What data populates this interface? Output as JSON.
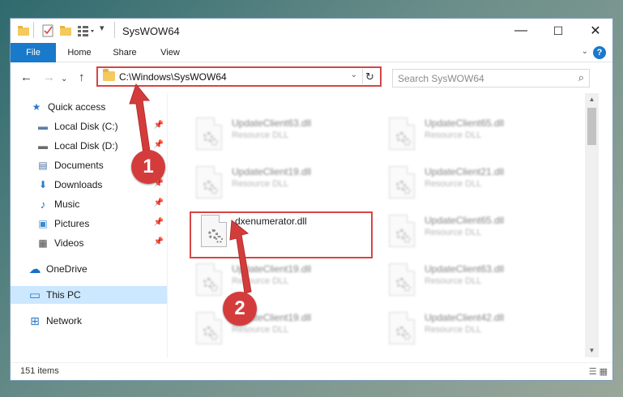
{
  "window": {
    "title": "SysWOW64",
    "controls": {
      "minimize": "—",
      "maximize": "☐",
      "close": "✕"
    }
  },
  "ribbon": {
    "tabs": [
      {
        "label": "File"
      },
      {
        "label": "Share"
      },
      {
        "label": "View"
      }
    ],
    "home_label": "Home",
    "help": "?",
    "collapse": "⌄"
  },
  "navbar": {
    "back": "←",
    "forward": "→",
    "recent": "⌄",
    "up": "↑",
    "path": "C:\\Windows\\SysWOW64",
    "dropdown": "⌄",
    "refresh": "↻",
    "search_placeholder": "Search SysWOW64",
    "search_icon": "⌕"
  },
  "sidebar": {
    "items": [
      {
        "label": "Quick access",
        "icon": "star-icon",
        "glyph": "★",
        "color": "#2a79c8"
      },
      {
        "label": "Local Disk (C:)",
        "icon": "drive-icon",
        "glyph": "▬",
        "color": "#5b7fa6",
        "pinned": "📌"
      },
      {
        "label": "Local Disk (D:)",
        "icon": "drive-icon",
        "glyph": "▬",
        "color": "#6a6a6a",
        "pinned": "📌"
      },
      {
        "label": "Documents",
        "icon": "documents-icon",
        "glyph": "▤",
        "color": "#4a6fa0",
        "pinned": "📌"
      },
      {
        "label": "Downloads",
        "icon": "download-icon",
        "glyph": "⬇",
        "color": "#2a79c8",
        "pinned": "📌"
      },
      {
        "label": "Music",
        "icon": "music-icon",
        "glyph": "♪",
        "color": "#2a79c8",
        "pinned": "📌"
      },
      {
        "label": "Pictures",
        "icon": "pictures-icon",
        "glyph": "▣",
        "color": "#3a8ad0",
        "pinned": "📌"
      },
      {
        "label": "Videos",
        "icon": "videos-icon",
        "glyph": "▦",
        "color": "#444",
        "pinned": "📌"
      },
      {
        "label": "OneDrive",
        "icon": "cloud-icon",
        "glyph": "☁",
        "color": "#1a6fc9"
      },
      {
        "label": "This PC",
        "icon": "computer-icon",
        "glyph": "▭",
        "color": "#2a79c8"
      },
      {
        "label": "Network",
        "icon": "network-icon",
        "glyph": "⊞",
        "color": "#2a79c8"
      }
    ]
  },
  "files": {
    "left": [
      {
        "name": "UpdateClient63.dll",
        "type": "Resource DLL"
      },
      {
        "name": "UpdateClient19.dll",
        "type": "Resource DLL"
      },
      {
        "name": "dxenumerator.dll",
        "type": ""
      },
      {
        "name": "UpdateClient19.dll",
        "type": "Resource DLL"
      },
      {
        "name": "UpdateClient19.dll",
        "type": "Resource DLL"
      }
    ],
    "right": [
      {
        "name": "UpdateClient65.dll",
        "type": "Resource DLL"
      },
      {
        "name": "UpdateClient21.dll",
        "type": "Resource DLL"
      },
      {
        "name": "UpdateClient65.dll",
        "type": "Resource DLL"
      },
      {
        "name": "UpdateClient63.dll",
        "type": "Resource DLL"
      },
      {
        "name": "UpdateClient42.dll",
        "type": "Resource DLL"
      }
    ]
  },
  "status": {
    "count": "151 items",
    "views": "☰ ▦"
  },
  "callouts": {
    "one": "1",
    "two": "2"
  },
  "colors": {
    "accent": "#1979ca",
    "callout": "#d43c3c",
    "selected": "#cce8ff"
  }
}
